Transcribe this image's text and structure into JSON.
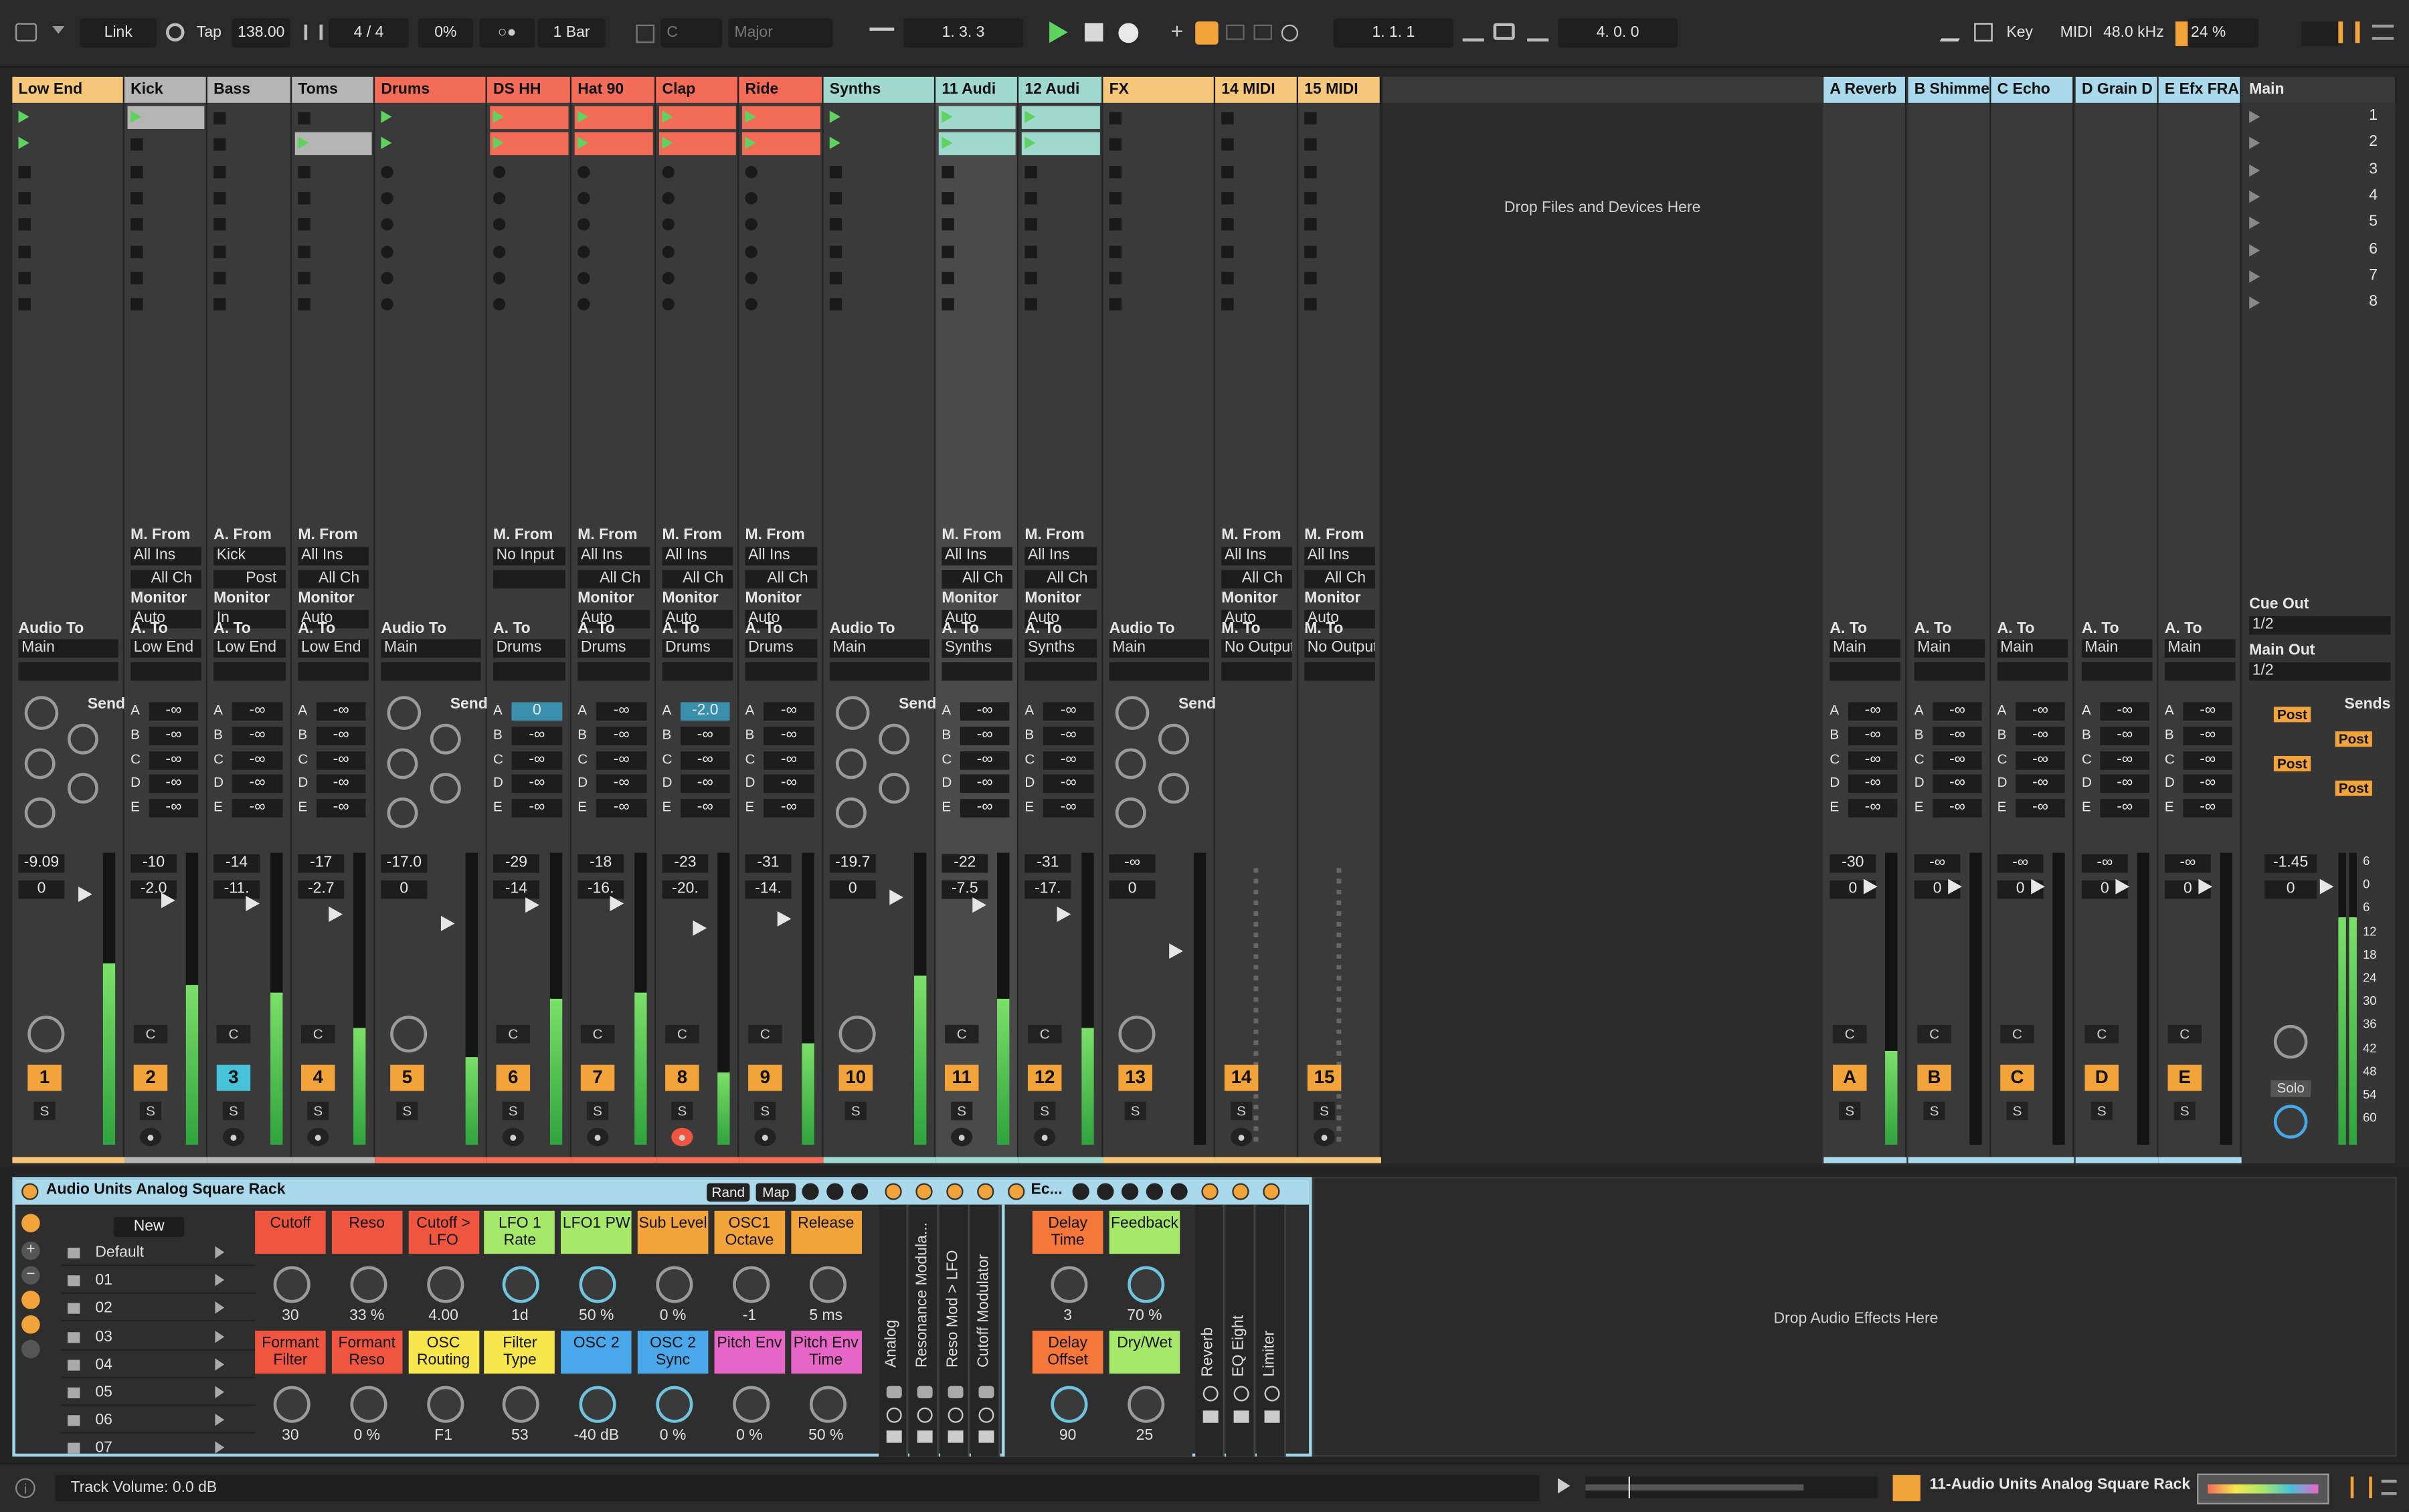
{
  "transport": {
    "link": "Link",
    "tap": "Tap",
    "tempo": "138.00",
    "meter": "4 / 4",
    "swing": "0%",
    "quantize": "1 Bar",
    "key": "C",
    "scale": "Major",
    "arrangement_position": "1.   3.   3",
    "loop_start": "1.   1.   1",
    "loop_length": "4.   0.   0",
    "key_label": "Key",
    "midi_label": "MIDI",
    "sample_rate": "48.0 kHz",
    "cpu": "24 %"
  },
  "tracks": [
    {
      "name": "Low End",
      "color": "#f6c77a",
      "kind": "group",
      "input_from": "",
      "input_ch": "",
      "monitor": "",
      "routing_label": "Audio To",
      "output": "Main",
      "vol": "-9.09",
      "pan": "0",
      "num": "1",
      "num_color": "#f2a33a",
      "meter": 0.62,
      "clips": [
        1,
        1,
        0,
        0,
        0,
        0,
        0,
        0
      ]
    },
    {
      "name": "Kick",
      "color": "#b5b5b5",
      "kind": "midi",
      "input_from": "M. From",
      "input_src": "All Ins",
      "input_ch": "All Ch",
      "monitor": "Auto",
      "routing_label": "A. To",
      "output": "Low End",
      "vol": "-10",
      "pan": "-2.0",
      "num": "2",
      "num_color": "#f2a33a",
      "meter": 0.55,
      "clips": [
        1,
        0,
        0,
        0,
        0,
        0,
        0,
        0
      ]
    },
    {
      "name": "Bass",
      "color": "#b5b5b5",
      "kind": "audio",
      "input_from": "A. From",
      "input_src": "Kick",
      "input_ch": "Post",
      "monitor": "In",
      "routing_label": "A. To",
      "output": "Low End",
      "vol": "-14",
      "pan": "-11.",
      "num": "3",
      "num_color": "#47c2d9",
      "meter": 0.52,
      "clips": [
        0,
        0,
        0,
        0,
        0,
        0,
        0,
        0
      ]
    },
    {
      "name": "Toms",
      "color": "#b5b5b5",
      "kind": "midi",
      "input_from": "M. From",
      "input_src": "All Ins",
      "input_ch": "All Ch",
      "monitor": "Auto",
      "routing_label": "A. To",
      "output": "Low End",
      "vol": "-17",
      "pan": "-2.7",
      "num": "4",
      "num_color": "#f2a33a",
      "meter": 0.4,
      "clips": [
        0,
        1,
        0,
        0,
        0,
        0,
        0,
        0
      ]
    },
    {
      "name": "Drums",
      "color": "#f26c58",
      "kind": "group",
      "input_from": "",
      "input_ch": "",
      "monitor": "",
      "routing_label": "Audio To",
      "output": "Main",
      "vol": "-17.0",
      "pan": "0",
      "num": "5",
      "num_color": "#f2a33a",
      "meter": 0.3,
      "clips": [
        1,
        1,
        0,
        0,
        0,
        0,
        0,
        0
      ]
    },
    {
      "name": "DS HH",
      "color": "#f26c58",
      "kind": "midi",
      "input_from": "M. From",
      "input_src": "No Input",
      "input_ch": "",
      "monitor": "",
      "routing_label": "A. To",
      "output": "Drums",
      "vol": "-29",
      "pan": "-14",
      "num": "6",
      "num_color": "#f2a33a",
      "meter": 0.5,
      "clips": [
        1,
        1,
        0,
        0,
        0,
        0,
        0,
        0
      ]
    },
    {
      "name": "Hat 90",
      "color": "#f26c58",
      "kind": "midi",
      "input_from": "M. From",
      "input_src": "All Ins",
      "input_ch": "All Ch",
      "monitor": "Auto",
      "routing_label": "A. To",
      "output": "Drums",
      "vol": "-18",
      "pan": "-16.",
      "num": "7",
      "num_color": "#f2a33a",
      "meter": 0.52,
      "clips": [
        1,
        1,
        0,
        0,
        0,
        0,
        0,
        0
      ]
    },
    {
      "name": "Clap",
      "color": "#f26c58",
      "kind": "midi",
      "input_from": "M. From",
      "input_src": "All Ins",
      "input_ch": "All Ch",
      "monitor": "Auto",
      "routing_label": "A. To",
      "output": "Drums",
      "vol": "-23",
      "pan": "-20.",
      "num": "8",
      "num_color": "#f2a33a",
      "meter": 0.25,
      "clips": [
        1,
        1,
        0,
        0,
        0,
        0,
        0,
        0
      ]
    },
    {
      "name": "Ride",
      "color": "#f26c58",
      "kind": "midi",
      "input_from": "M. From",
      "input_src": "All Ins",
      "input_ch": "All Ch",
      "monitor": "Auto",
      "routing_label": "A. To",
      "output": "Drums",
      "vol": "-31",
      "pan": "-14.",
      "num": "9",
      "num_color": "#f2a33a",
      "meter": 0.35,
      "clips": [
        1,
        1,
        0,
        0,
        0,
        0,
        0,
        0
      ]
    },
    {
      "name": "Synths",
      "color": "#9fd8cd",
      "kind": "group",
      "input_from": "",
      "input_ch": "",
      "monitor": "",
      "routing_label": "Audio To",
      "output": "Main",
      "vol": "-19.7",
      "pan": "0",
      "num": "10",
      "num_color": "#f2a33a",
      "meter": 0.58,
      "clips": [
        1,
        1,
        0,
        0,
        0,
        0,
        0,
        0
      ]
    },
    {
      "name": "11 Audi",
      "color": "#9fd8cd",
      "kind": "midi",
      "input_from": "M. From",
      "input_src": "All Ins",
      "input_ch": "All Ch",
      "monitor": "Auto",
      "routing_label": "A. To",
      "output": "Synths",
      "vol": "-22",
      "pan": "-7.5",
      "num": "11",
      "num_color": "#f2a33a",
      "meter": 0.5,
      "clips": [
        1,
        1,
        0,
        0,
        0,
        0,
        0,
        0
      ]
    },
    {
      "name": "12 Audi",
      "color": "#9fd8cd",
      "kind": "midi",
      "input_from": "M. From",
      "input_src": "All Ins",
      "input_ch": "All Ch",
      "monitor": "Auto",
      "routing_label": "A. To",
      "output": "Synths",
      "vol": "-31",
      "pan": "-17.",
      "num": "12",
      "num_color": "#f2a33a",
      "meter": 0.4,
      "clips": [
        1,
        1,
        0,
        0,
        0,
        0,
        0,
        0
      ]
    },
    {
      "name": "FX",
      "color": "#f6c77a",
      "kind": "group",
      "input_from": "",
      "input_ch": "",
      "monitor": "",
      "routing_label": "Audio To",
      "output": "Main",
      "vol": "-∞",
      "pan": "0",
      "num": "13",
      "num_color": "#f2a33a",
      "meter": 0,
      "clips": [
        0,
        0,
        0,
        0,
        0,
        0,
        0,
        0
      ]
    },
    {
      "name": "14 MIDI",
      "color": "#f6c77a",
      "kind": "midi",
      "input_from": "M. From",
      "input_src": "All Ins",
      "input_ch": "All Ch",
      "monitor": "Auto",
      "routing_label": "M. To",
      "output": "No Output",
      "vol": "",
      "pan": "",
      "num": "14",
      "num_color": "#f2a33a",
      "meter": 0,
      "clips": [
        0,
        0,
        0,
        0,
        0,
        0,
        0,
        0
      ]
    },
    {
      "name": "15 MIDI",
      "color": "#f6c77a",
      "kind": "midi",
      "input_from": "M. From",
      "input_src": "All Ins",
      "input_ch": "All Ch",
      "monitor": "Auto",
      "routing_label": "M. To",
      "output": "No Output",
      "vol": "",
      "pan": "",
      "num": "15",
      "num_color": "#f2a33a",
      "meter": 0,
      "clips": [
        0,
        0,
        0,
        0,
        0,
        0,
        0,
        0
      ]
    }
  ],
  "returns": [
    {
      "name": "A Reverb",
      "vol": "-30",
      "pan": "0",
      "letter": "A",
      "output": "Main"
    },
    {
      "name": "B Shimme",
      "vol": "-∞",
      "pan": "0",
      "letter": "B",
      "output": "Main"
    },
    {
      "name": "C Echo",
      "vol": "-∞",
      "pan": "0",
      "letter": "C",
      "output": "Main"
    },
    {
      "name": "D Grain D",
      "vol": "-∞",
      "pan": "0",
      "letter": "D",
      "output": "Main"
    },
    {
      "name": "E Efx FRA",
      "vol": "-∞",
      "pan": "0",
      "letter": "E",
      "output": "Main"
    }
  ],
  "main": {
    "name": "Main",
    "scenes": [
      "1",
      "2",
      "3",
      "4",
      "5",
      "6",
      "7",
      "8"
    ],
    "cue_out_label": "Cue Out",
    "cue_out": "1/2",
    "main_out_label": "Main Out",
    "main_out": "1/2",
    "vol": "-1.45",
    "pan": "0",
    "solo": "Solo",
    "post": "Post",
    "db_scale": [
      "6",
      "0",
      "6",
      "12",
      "18",
      "24",
      "30",
      "36",
      "42",
      "48",
      "54",
      "60"
    ]
  },
  "sends": {
    "label": "Sends",
    "letters": [
      "A",
      "B",
      "C",
      "D",
      "E"
    ],
    "inf": "-∞",
    "ds_hh_a": "0",
    "clap_a": "-2.0"
  },
  "drop_files": "Drop Files and Devices Here",
  "drop_audio": "Drop Audio Effects Here",
  "device": {
    "title": "Audio Units Analog Square Rack",
    "rand": "Rand",
    "map": "Map",
    "new": "New",
    "presets": [
      "Default",
      "01",
      "02",
      "03",
      "04",
      "05",
      "06",
      "07"
    ],
    "macros": [
      {
        "label": "Cutoff",
        "value": "30",
        "color": "#f0553f"
      },
      {
        "label": "Reso",
        "value": "33 %",
        "color": "#f0553f"
      },
      {
        "label": "Cutoff > LFO",
        "value": "4.00",
        "color": "#f0553f"
      },
      {
        "label": "LFO 1 Rate",
        "value": "1d",
        "color": "#a6e86a"
      },
      {
        "label": "LFO1 PW",
        "value": "50 %",
        "color": "#a6e86a"
      },
      {
        "label": "Sub Level",
        "value": "0 %",
        "color": "#f2a33a"
      },
      {
        "label": "OSC1 Octave",
        "value": "-1",
        "color": "#f2a33a"
      },
      {
        "label": "Release",
        "value": "5 ms",
        "color": "#f2a33a"
      },
      {
        "label": "Formant Filter",
        "value": "30",
        "color": "#f0553f"
      },
      {
        "label": "Formant Reso",
        "value": "0 %",
        "color": "#f0553f"
      },
      {
        "label": "OSC Routing",
        "value": "F1",
        "color": "#f7e64c"
      },
      {
        "label": "Filter Type",
        "value": "53",
        "color": "#f7e64c"
      },
      {
        "label": "OSC 2",
        "value": "-40 dB",
        "color": "#4aa8ea"
      },
      {
        "label": "OSC 2 Sync",
        "value": "0 %",
        "color": "#4aa8ea"
      },
      {
        "label": "Pitch Env",
        "value": "0 %",
        "color": "#e765c7"
      },
      {
        "label": "Pitch Env Time",
        "value": "50 %",
        "color": "#e765c7"
      }
    ],
    "chain": [
      "Analog",
      "Resonance Modula...",
      "Reso Mod > LFO",
      "Cutoff Modulator"
    ],
    "echo_title": "Ec...",
    "echo_macros": [
      {
        "label": "Delay Time",
        "value": "3",
        "color": "#f5773a"
      },
      {
        "label": "Feedback",
        "value": "70 %",
        "color": "#a6e86a"
      },
      {
        "label": "Delay Offset",
        "value": "90",
        "color": "#f5773a"
      },
      {
        "label": "Dry/Wet",
        "value": "25",
        "color": "#a6e86a"
      }
    ],
    "fx_chain": [
      "Reverb",
      "EQ Eight",
      "Limiter"
    ]
  },
  "status": {
    "text": "Track Volume: 0.0 dB",
    "selected": "11-Audio Units Analog Square Rack"
  }
}
